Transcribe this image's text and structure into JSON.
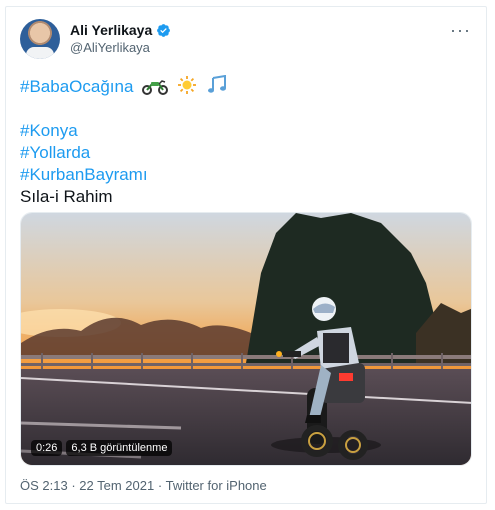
{
  "author": {
    "display_name": "Ali Yerlikaya",
    "handle": "@AliYerlikaya",
    "verified": true
  },
  "tweet": {
    "lines": [
      {
        "text": "#BabaOcağına",
        "type": "hashtag"
      },
      {
        "text": "",
        "type": "gap"
      },
      {
        "text": "#Konya",
        "type": "hashtag"
      },
      {
        "text": "#Yollarda",
        "type": "hashtag"
      },
      {
        "text": "#KurbanBayramı",
        "type": "hashtag"
      },
      {
        "text": "Sıla-i Rahim",
        "type": "text"
      }
    ],
    "emojis": [
      "motorcycle-icon",
      "sun-icon",
      "music-notes-icon"
    ]
  },
  "media": {
    "duration": "0:26",
    "views": "6,3 B görüntülenme"
  },
  "meta": {
    "time": "ÖS 2:13",
    "date": "22 Tem 2021",
    "source": "Twitter for iPhone",
    "separator": "·"
  },
  "colors": {
    "hashtag": "#1d9bf0",
    "verified": "#1d9bf0",
    "muted": "#536471"
  }
}
